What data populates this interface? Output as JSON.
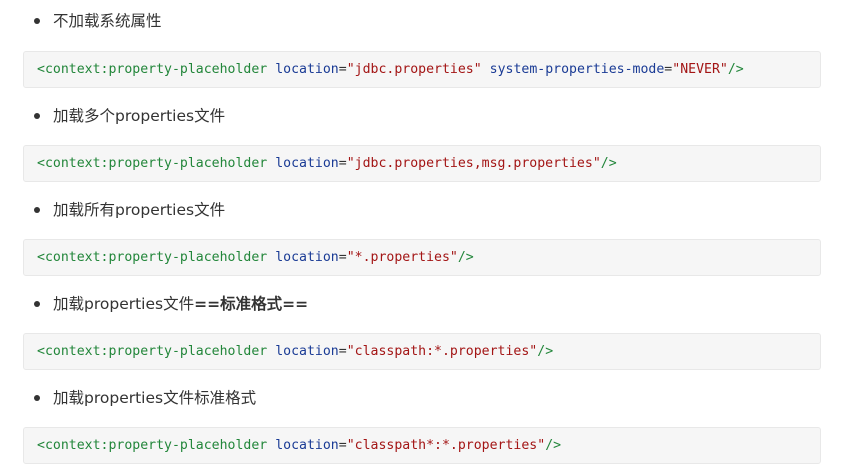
{
  "items": [
    {
      "label": "不加载系统属性",
      "code": {
        "tag_open": "<context:property-placeholder",
        "attr1": "location",
        "val1": "\"jdbc.properties\"",
        "attr2": "system-properties-mode",
        "val2": "\"NEVER\"",
        "tag_close": "/>"
      }
    },
    {
      "label": "加载多个properties文件",
      "code": {
        "tag_open": "<context:property-placeholder",
        "attr1": "location",
        "val1": "\"jdbc.properties,msg.properties\"",
        "tag_close": "/>"
      }
    },
    {
      "label": "加载所有properties文件",
      "code": {
        "tag_open": "<context:property-placeholder",
        "attr1": "location",
        "val1": "\"*.properties\"",
        "tag_close": "/>"
      }
    },
    {
      "label_plain": "加载properties文件",
      "label_bold": "==标准格式==",
      "code": {
        "tag_open": "<context:property-placeholder",
        "attr1": "location",
        "val1": "\"classpath:*.properties\"",
        "tag_close": "/>"
      }
    },
    {
      "label": "加载properties文件标准格式",
      "code": {
        "tag_open": "<context:property-placeholder",
        "attr1": "location",
        "val1": "\"classpath*:*.properties\"",
        "tag_close": "/>"
      }
    }
  ],
  "colors": {
    "tag": "#22863a",
    "attribute": "#1a3b95",
    "value": "#a31515",
    "code_background": "#f6f6f6",
    "text": "#333333"
  }
}
